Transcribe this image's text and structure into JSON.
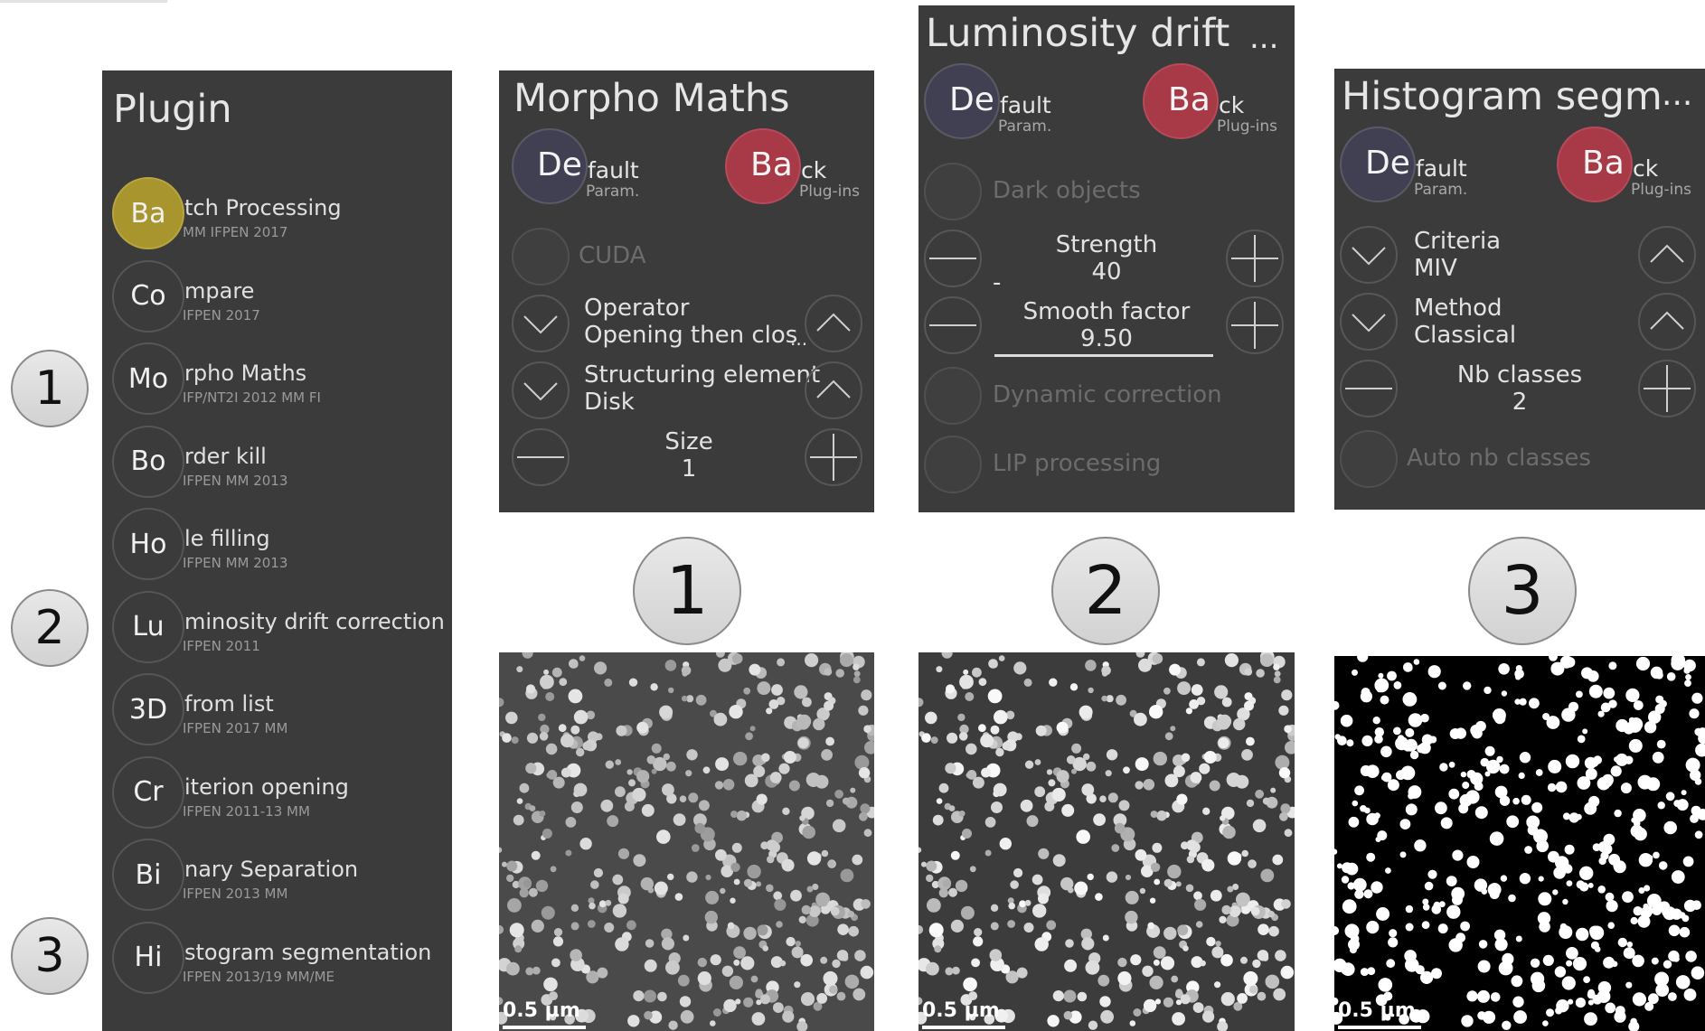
{
  "markers_left": [
    "1",
    "2",
    "3"
  ],
  "markers_bottom": [
    "1",
    "2",
    "3"
  ],
  "plugin_panel": {
    "title": "Plugin",
    "items": [
      {
        "abbr": "Ba",
        "rest": "tch Processing",
        "sub": "MM IFPEN 2017",
        "active": true
      },
      {
        "abbr": "Co",
        "rest": "mpare",
        "sub": "IFPEN 2017",
        "active": false
      },
      {
        "abbr": "Mo",
        "rest": "rpho Maths",
        "sub": "IFP/NT2I 2012 MM FI",
        "active": false
      },
      {
        "abbr": "Bo",
        "rest": "rder kill",
        "sub": "IFPEN MM 2013",
        "active": false
      },
      {
        "abbr": "Ho",
        "rest": "le filling",
        "sub": "IFPEN MM 2013",
        "active": false
      },
      {
        "abbr": "Lu",
        "rest": "minosity drift correction",
        "sub": "IFPEN 2011",
        "active": false
      },
      {
        "abbr": "3D",
        "rest": " from list",
        "sub": "IFPEN 2017 MM",
        "active": false
      },
      {
        "abbr": "Cr",
        "rest": "iterion opening",
        "sub": "IFPEN 2011-13 MM",
        "active": false
      },
      {
        "abbr": "Bi",
        "rest": "nary Separation",
        "sub": "IFPEN 2013 MM",
        "active": false
      },
      {
        "abbr": "Hi",
        "rest": "stogram segmentation",
        "sub": "IFPEN 2013/19 MM/ME",
        "active": false
      }
    ]
  },
  "common": {
    "default_abbr": "De",
    "default_rest": "fault",
    "default_sub": "Param.",
    "back_abbr": "Ba",
    "back_rest": "ck",
    "back_sub": "Plug-ins"
  },
  "morpho": {
    "title": "Morpho Maths",
    "cuda": "CUDA",
    "operator_label": "Operator",
    "operator_value": "Opening  then clos",
    "operator_more": "...",
    "se_label": "Structuring element",
    "se_value": "Disk",
    "size_label": "Size",
    "size_value": "1"
  },
  "lumino": {
    "title": "Luminosity drift",
    "title_more": "...",
    "dark_objects": "Dark objects",
    "strength_label": "Strength",
    "strength_value": "40",
    "strength_mark": "-",
    "smooth_label": "Smooth factor",
    "smooth_value": "9.50",
    "dynamic": "Dynamic correction",
    "lip": "LIP processing"
  },
  "histo": {
    "title": "Histogram segm",
    "title_more": "...",
    "criteria_label": "Criteria",
    "criteria_value": "MIV",
    "method_label": "Method",
    "method_value": "Classical",
    "nb_label": "Nb classes",
    "nb_value": "2",
    "auto": "Auto nb classes"
  },
  "images": [
    {
      "scale": "0.5 µm",
      "style": "grey"
    },
    {
      "scale": "0.5 µm",
      "style": "grey-contrast"
    },
    {
      "scale": "0.5 µm",
      "style": "binary"
    }
  ],
  "colors": {
    "panel_bg": "#3b3b3b",
    "active_plugin": "#a8952e",
    "default_btn": "#404052",
    "back_btn": "#a83a48"
  }
}
